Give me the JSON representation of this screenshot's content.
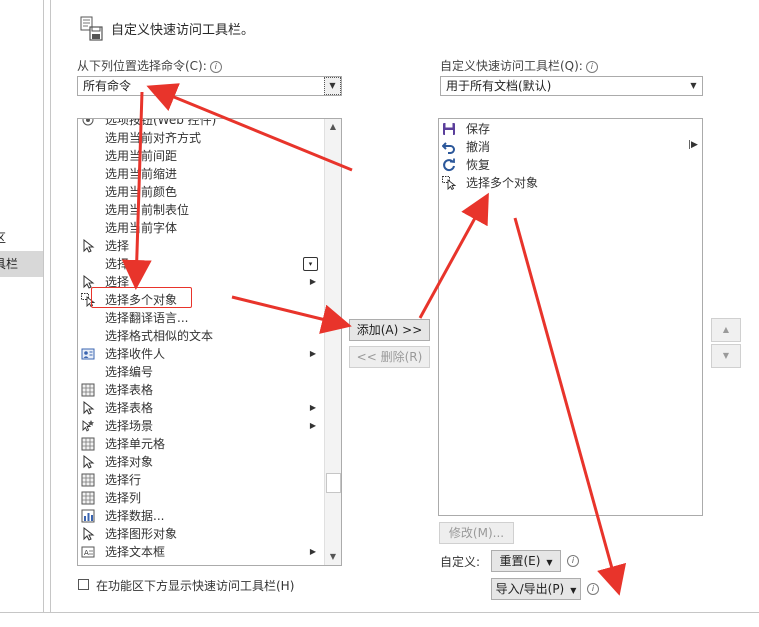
{
  "nav": {
    "items": [
      {
        "label": "区",
        "selected": false
      },
      {
        "label": "具栏",
        "selected": true
      }
    ]
  },
  "header": {
    "title": "自定义快速访问工具栏。"
  },
  "left": {
    "choose_label": "从下列位置选择命令(C):",
    "choose_value": "所有命令",
    "commands": [
      {
        "label": "选项按钮(Web 控件)",
        "icon": "option-button-icon",
        "submenu": false
      },
      {
        "label": "选用当前对齐方式",
        "icon": "",
        "submenu": false
      },
      {
        "label": "选用当前间距",
        "icon": "",
        "submenu": false
      },
      {
        "label": "选用当前缩进",
        "icon": "",
        "submenu": false
      },
      {
        "label": "选用当前颜色",
        "icon": "",
        "submenu": false
      },
      {
        "label": "选用当前制表位",
        "icon": "",
        "submenu": false
      },
      {
        "label": "选用当前字体",
        "icon": "",
        "submenu": false
      },
      {
        "label": "选择",
        "icon": "cursor-icon",
        "submenu": false
      },
      {
        "label": "选择",
        "icon": "",
        "submenu": false,
        "dropdown": true
      },
      {
        "label": "选择",
        "icon": "cursor-icon",
        "submenu": true
      },
      {
        "label": "选择多个对象",
        "icon": "select-multiple-icon",
        "submenu": false
      },
      {
        "label": "选择翻译语言...",
        "icon": "",
        "submenu": false
      },
      {
        "label": "选择格式相似的文本",
        "icon": "",
        "submenu": false
      },
      {
        "label": "选择收件人",
        "icon": "recipients-icon",
        "submenu": true
      },
      {
        "label": "选择编号",
        "icon": "",
        "submenu": false
      },
      {
        "label": "选择表格",
        "icon": "table-icon",
        "submenu": false
      },
      {
        "label": "选择表格",
        "icon": "cursor-icon",
        "submenu": true
      },
      {
        "label": "选择场景",
        "icon": "scene-icon",
        "submenu": true
      },
      {
        "label": "选择单元格",
        "icon": "table-icon",
        "submenu": false
      },
      {
        "label": "选择对象",
        "icon": "cursor-icon",
        "submenu": false
      },
      {
        "label": "选择行",
        "icon": "table-icon",
        "submenu": false
      },
      {
        "label": "选择列",
        "icon": "table-icon",
        "submenu": false
      },
      {
        "label": "选择数据...",
        "icon": "chart-data-icon",
        "submenu": false
      },
      {
        "label": "选择图形对象",
        "icon": "cursor-icon",
        "submenu": false
      },
      {
        "label": "选择文本框",
        "icon": "textbox-icon",
        "submenu": true
      }
    ],
    "scroll_fraction": 0.85,
    "show_below_label": "在功能区下方显示快速访问工具栏(H)"
  },
  "middle": {
    "add_label": "添加(A) >>",
    "remove_label": "<< 删除(R)"
  },
  "right": {
    "qat_label": "自定义快速访问工具栏(Q):",
    "qat_value": "用于所有文档(默认)",
    "items": [
      {
        "label": "保存",
        "icon": "save-icon"
      },
      {
        "label": "撤消",
        "icon": "undo-icon"
      },
      {
        "label": "恢复",
        "icon": "redo-icon"
      },
      {
        "label": "选择多个对象",
        "icon": "select-multiple-icon"
      }
    ],
    "modify_label": "修改(M)...",
    "customize_label": "自定义:",
    "reset_label": "重置(E)",
    "import_export_label": "导入/导出(P)"
  },
  "colors": {
    "annotation_red": "#e8342b",
    "selection_gray": "#d8d8d8"
  }
}
